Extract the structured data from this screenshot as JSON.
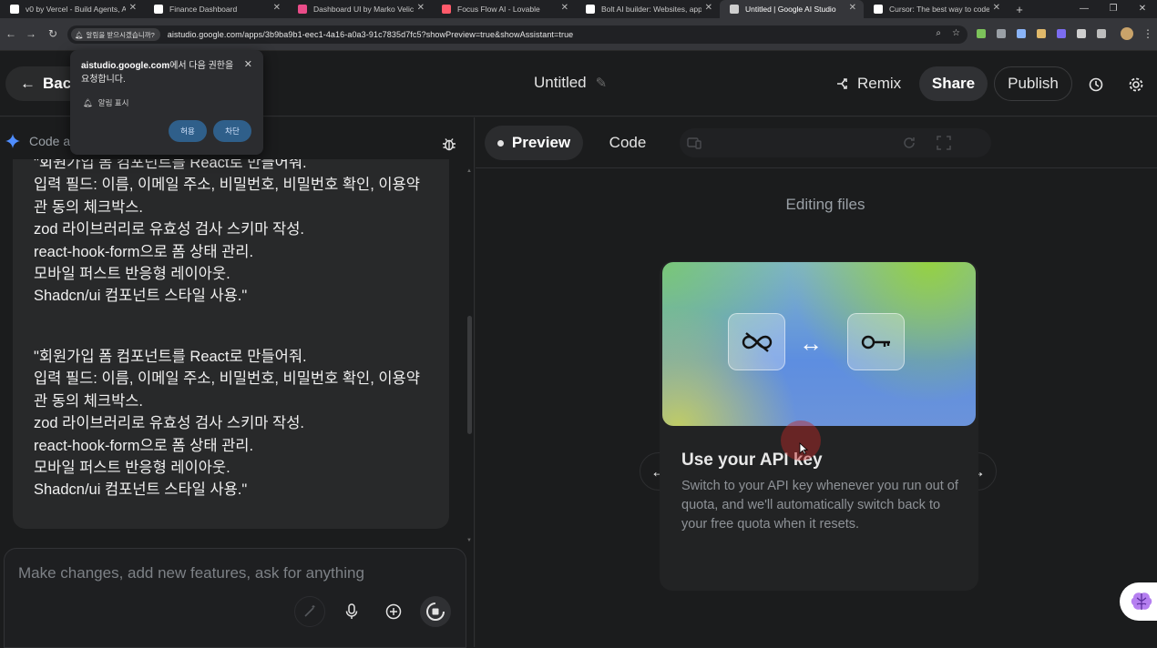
{
  "browser": {
    "tabs": [
      {
        "title": "v0 by Vercel - Build Agents, A",
        "favicon": "v0-icon",
        "color": "#ffffff"
      },
      {
        "title": "Finance Dashboard",
        "favicon": "v0-icon",
        "color": "#ffffff"
      },
      {
        "title": "Dashboard UI by Marko Velick",
        "favicon": "dribbble-icon",
        "color": "#ea4c89"
      },
      {
        "title": "Focus Flow AI - Lovable",
        "favicon": "lovable-icon",
        "color": "#ff5a6a"
      },
      {
        "title": "Bolt AI builder: Websites, app",
        "favicon": "bolt-icon",
        "color": "#ffffff"
      },
      {
        "title": "Untitled | Google AI Studio",
        "favicon": "ai-studio-icon",
        "color": "#cfcfcf",
        "active": true
      },
      {
        "title": "Cursor: The best way to code",
        "favicon": "cursor-icon",
        "color": "#ffffff"
      }
    ],
    "url": "aistudio.google.com/apps/3b9ba9b1-eec1-4a16-a0a3-91c7835d7fc5?showPreview=true&showAssistant=true",
    "permission_chip": "알림을 받으시겠습니까?"
  },
  "popup": {
    "site": "aistudio.google.com",
    "message": "에서 다음 권한을 요청합니다.",
    "permission": "알림 표시",
    "allow_label": "허용",
    "block_label": "차단"
  },
  "header": {
    "back_label": "Back",
    "title": "Untitled",
    "remix_label": "Remix",
    "share_label": "Share",
    "publish_label": "Publish"
  },
  "assistant": {
    "label": "Code a",
    "messages": [
      {
        "lines": [
          "\"회원가입 폼 컴포넌트를 React로 만들어줘.",
          "입력 필드: 이름, 이메일 주소, 비밀번호, 비밀번호 확인, 이용약",
          "관 동의 체크박스.",
          "zod 라이브러리로 유효성 검사 스키마 작성.",
          "react-hook-form으로 폼 상태 관리.",
          "모바일 퍼스트 반응형 레이아웃.",
          "Shadcn/ui 컴포넌트 스타일 사용.\""
        ]
      },
      {
        "lines": [
          "\"회원가입 폼 컴포넌트를 React로 만들어줘.",
          "입력 필드: 이름, 이메일 주소, 비밀번호, 비밀번호 확인, 이용약",
          "관 동의 체크박스.",
          "zod 라이브러리로 유효성 검사 스키마 작성.",
          "react-hook-form으로 폼 상태 관리.",
          "모바일 퍼스트 반응형 레이아웃.",
          "Shadcn/ui 컴포넌트 스타일 사용.\""
        ]
      }
    ],
    "input_placeholder": "Make changes, add new features, ask for anything"
  },
  "preview": {
    "preview_tab": "Preview",
    "code_tab": "Code",
    "status": "Editing files",
    "card": {
      "title": "Use your API key",
      "description": "Switch to your API key whenever you run out of quota, and we'll automatically switch back to your free quota when it resets.",
      "left_icon": "infinity-off-icon",
      "right_icon": "key-icon"
    }
  },
  "colors": {
    "background": "#1b1c1d",
    "bubble": "#28292a",
    "accent_button": "#2f5f8a"
  }
}
